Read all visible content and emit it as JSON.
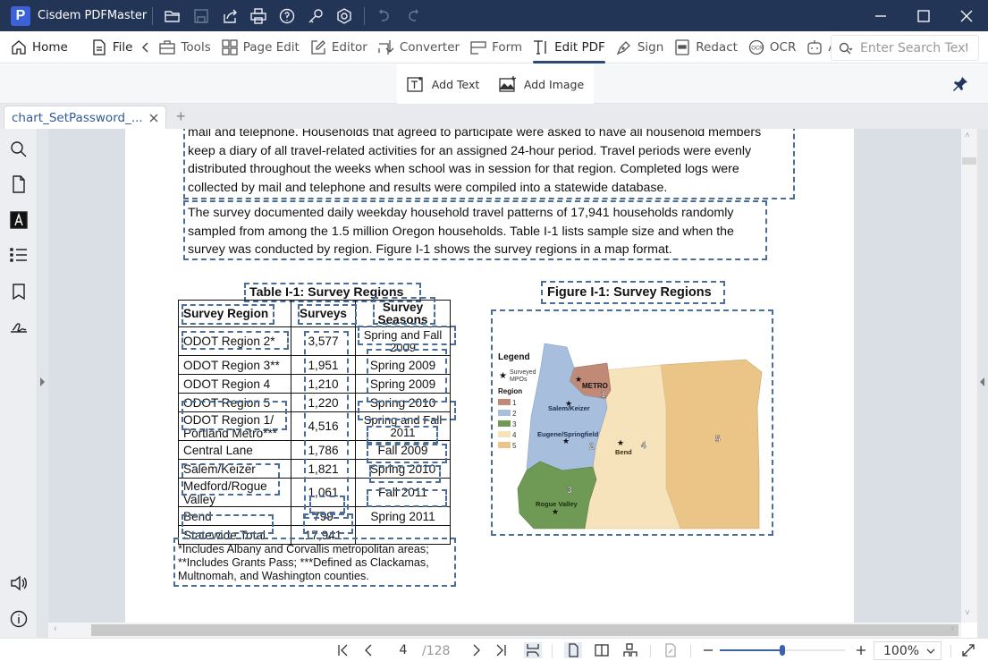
{
  "app": {
    "title": "Cisdem PDFMaster",
    "logo_letter": "P",
    "toolbar_icons": [
      "open-folder-icon",
      "save-icon",
      "share-icon",
      "print-icon",
      "help-icon",
      "key-icon",
      "settings-icon",
      "undo-icon",
      "redo-icon"
    ]
  },
  "menu": {
    "items": [
      {
        "label": "Home",
        "icon": "home-icon"
      },
      {
        "label": "File",
        "icon": "file-icon"
      },
      {
        "label": "Tools",
        "icon": "toolbox-icon"
      },
      {
        "label": "Page Edit",
        "icon": "grid-icon"
      },
      {
        "label": "Editor",
        "icon": "edit-icon"
      },
      {
        "label": "Converter",
        "icon": "convert-icon"
      },
      {
        "label": "Form",
        "icon": "form-icon"
      },
      {
        "label": "Edit PDF",
        "icon": "text-cursor-icon",
        "active": true
      },
      {
        "label": "Sign",
        "icon": "pen-icon"
      },
      {
        "label": "Redact",
        "icon": "redact-icon"
      },
      {
        "label": "OCR",
        "icon": "ocr-icon"
      },
      {
        "label": "AI",
        "icon": "ai-icon"
      }
    ],
    "search_placeholder": "Enter Search Text"
  },
  "subtoolbar": {
    "add_text": "Add Text",
    "add_image": "Add Image"
  },
  "tabs": [
    {
      "label": "chart_SetPassword_...",
      "active": true
    }
  ],
  "document": {
    "para1_lines": [
      "mail and telephone. Households that agreed to participate were asked to have all household members",
      "keep a diary of all travel-related activities for an assigned 24-hour period. Travel periods were evenly",
      "distributed throughout the weeks when school was in session for that region. Completed logs were",
      "collected by mail and telephone and results were compiled into a statewide database."
    ],
    "para2_lines": [
      "The survey documented daily weekday household travel patterns of 17,941 households randomly",
      "sampled from among the 1.5 million Oregon households. Table I-1 lists sample size and when the",
      "survey was conducted by region. Figure I-1 shows the survey regions in a map format."
    ],
    "table": {
      "title": "Table I-1:  Survey Regions",
      "headers": [
        "Survey Region",
        "Surveys",
        "Survey Seasons"
      ],
      "rows": [
        [
          "ODOT Region 2*",
          "3,577",
          "Spring and Fall 2009"
        ],
        [
          "ODOT Region 3**",
          "1,951",
          "Spring 2009"
        ],
        [
          "ODOT Region 4",
          "1,210",
          "Spring 2009"
        ],
        [
          "ODOT Region 5",
          "1,220",
          "Spring 2010"
        ],
        [
          "ODOT Region 1/ Portland Metro***",
          "4,516",
          "Spring and Fall 2011"
        ],
        [
          "Central Lane",
          "1,786",
          "Fall 2009"
        ],
        [
          "Salem/Keizer",
          "1,821",
          "Spring 2010"
        ],
        [
          "Medford/Rogue Valley",
          "1,061",
          "Fall 2011"
        ],
        [
          "Bend",
          "799",
          "Spring 2011"
        ],
        [
          "Statewide Total",
          "17,941",
          ""
        ]
      ],
      "note_lines": [
        "*Includes Albany and Corvallis metropolitan areas;",
        "**Includes Grants Pass; ***Defined as Clackamas,",
        "Multnomah, and Washington counties."
      ]
    },
    "figure": {
      "title": "Figure I-1:  Survey Regions",
      "legend_title": "Legend",
      "legend_mpo": "Surveyed MPOs",
      "legend_region": "Region",
      "regions": [
        {
          "label": "1",
          "color": "#c08a76"
        },
        {
          "label": "2",
          "color": "#a7bfdc"
        },
        {
          "label": "3",
          "color": "#6f9a56"
        },
        {
          "label": "4",
          "color": "#f7e3bb"
        },
        {
          "label": "5",
          "color": "#ebc488"
        }
      ],
      "map_labels": [
        "METRO",
        "Salem/Keizer",
        "Eugene/Springfield",
        "Bend",
        "Rogue Valley",
        "1",
        "2",
        "3",
        "4",
        "5"
      ]
    }
  },
  "statusbar": {
    "current_page": "4",
    "total_pages": "/128",
    "zoom_level": "100%",
    "zoom_slider_fraction": 0.5
  }
}
